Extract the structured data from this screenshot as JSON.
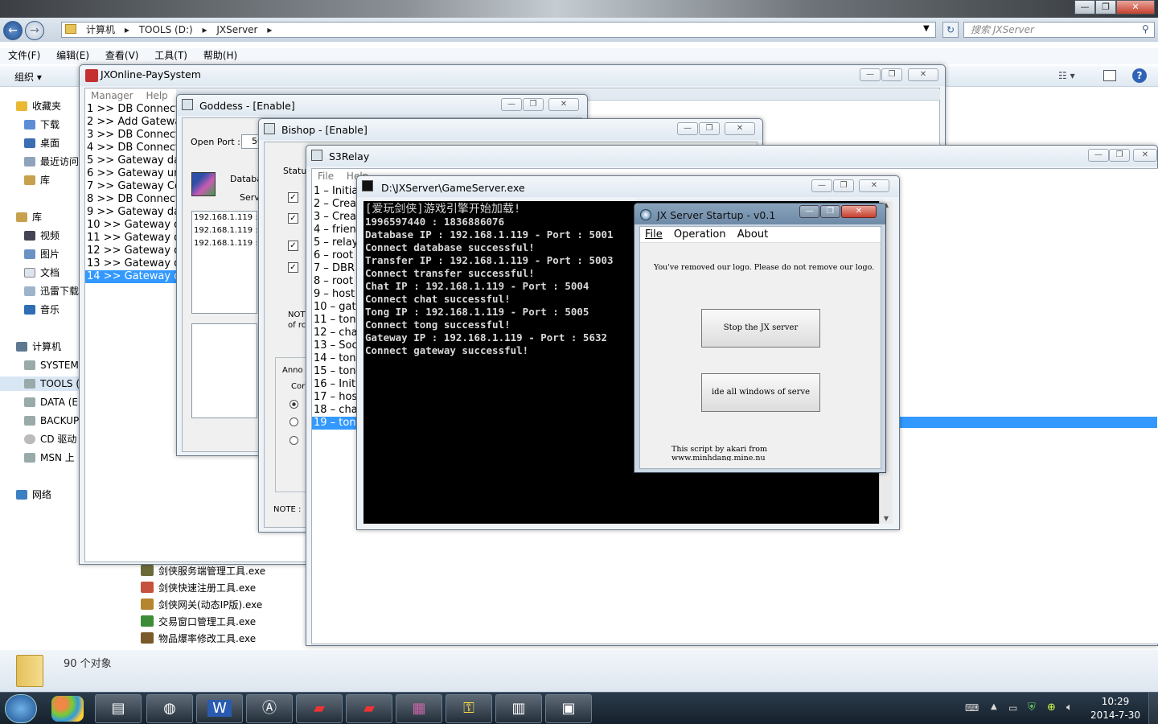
{
  "explorer": {
    "breadcrumb": [
      "计算机",
      "TOOLS (D:)",
      "JXServer"
    ],
    "search_placeholder": "搜索 JXServer",
    "menu": [
      "文件(F)",
      "编辑(E)",
      "查看(V)",
      "工具(T)",
      "帮助(H)"
    ],
    "toolbar": {
      "organize": "组织"
    },
    "nav": {
      "favorites": "收藏夹",
      "downloads": "下载",
      "desktop": "桌面",
      "recent": "最近访问",
      "lib1": "库",
      "library": "库",
      "videos": "视频",
      "pictures": "图片",
      "documents": "文档",
      "xunlei": "迅雷下载",
      "music": "音乐",
      "computer": "计算机",
      "system": "SYSTEM",
      "tools": "TOOLS (",
      "data": "DATA (E",
      "backup": "BACKUP",
      "cd": "CD 驱动",
      "msn": "MSN 上",
      "network": "网络"
    },
    "files": [
      "剑侠服务端管理工具.exe",
      "剑侠快速注册工具.exe",
      "剑侠网关(动态IP版).exe",
      "交易窗口管理工具.exe",
      "物品爆率修改工具.exe"
    ],
    "status": "90 个对象"
  },
  "paysys": {
    "title": "JXOnline-PaySystem",
    "menu": [
      "Manager",
      "Help"
    ],
    "log": [
      "1 >> DB Connect",
      "2 >> Add Gateway",
      "3 >> DB Connect",
      "4 >> DB Connect",
      "5 >> Gateway day",
      "6 >> Gateway unl",
      "7 >> Gateway Cor",
      "8 >> DB Connect",
      "9 >> Gateway day",
      "10 >> Gateway da",
      "11 >> Gateway da",
      "12 >> Gateway da",
      "13 >> Gateway da",
      "14 >> Gateway da"
    ]
  },
  "goddess": {
    "title": "Goddess - [Enable]",
    "open_port_label": "Open Port :",
    "open_port_value": "50",
    "db_label": "Databa",
    "serv_label": "Serv",
    "ips": [
      "192.168.1.119 :",
      "192.168.1.119 :",
      "192.168.1.119 :"
    ]
  },
  "bishop": {
    "title": "Bishop - [Enable]",
    "status_label": "Statu",
    "note_label": "NOT",
    "note_label2": "of rc",
    "announce_label": "Anno",
    "con_label": "Cor",
    "note2": "NOTE :"
  },
  "s3relay": {
    "title": "S3Relay",
    "menu": [
      "File",
      "Help"
    ],
    "log": [
      "1 – Initia",
      "2 – Crea",
      "3 – Crea",
      "4 – frien",
      "5 – relay",
      "6 – root",
      "7 – DBR",
      "8 – root",
      "9 – host",
      "10 – gat",
      "11 – tong",
      "12 – cha",
      "13 – Soc",
      "14 – tong",
      "15 – tong",
      "16 – Initi",
      "17 – hos",
      "18 – cha",
      "19 – tong"
    ]
  },
  "gameserver": {
    "title": "D:\\JXServer\\GameServer.exe",
    "lines": [
      "[爱玩剑侠]游戏引擎开始加载!",
      "1996597440 : 1836886076",
      "Database IP : 192.168.1.119 - Port : 5001",
      "Connect database successful!",
      "Transfer IP : 192.168.1.119 - Port : 5003",
      "Connect transfer successful!",
      "Chat IP : 192.168.1.119 - Port : 5004",
      "Connect chat successful!",
      "Tong IP : 192.168.1.119 - Port : 5005",
      "Connect tong successful!",
      "Gateway IP : 192.168.1.119  - Port : 5632",
      "Connect gateway successful!"
    ]
  },
  "startup": {
    "title": "JX Server Startup - v0.1",
    "menu": [
      "File",
      "Operation",
      "About"
    ],
    "notice": "You've removed our logo. Please do not remove our logo.",
    "stop_button": "Stop the JX server",
    "hide_button": "ide all windows of serve",
    "credit": "This script by akari from www.minhdang.mine.nu"
  },
  "taskbar": {
    "time": "10:29",
    "date": "2014-7-30"
  },
  "colors": {
    "selection": "#3399ff",
    "console_bg": "#000000",
    "taskbar": "#1d2a36"
  }
}
